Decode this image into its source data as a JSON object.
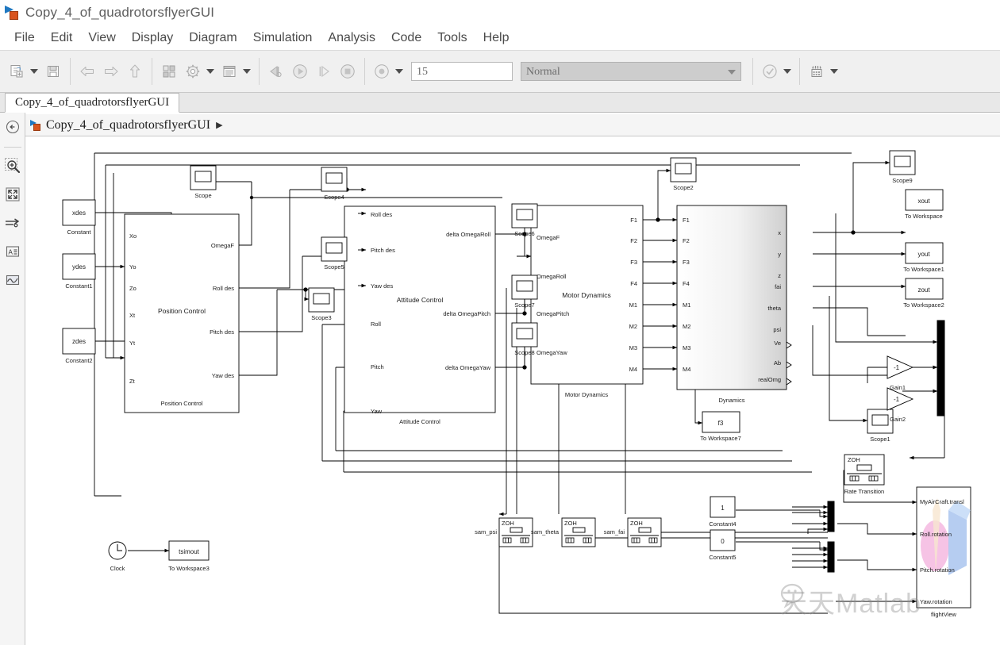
{
  "window": {
    "title": "Copy_4_of_quadrotorsflyerGUI",
    "app_icon": "simulink-model-icon"
  },
  "menubar": {
    "items": [
      "File",
      "Edit",
      "View",
      "Display",
      "Diagram",
      "Simulation",
      "Analysis",
      "Code",
      "Tools",
      "Help"
    ]
  },
  "toolbar": {
    "new_model": "new-model-icon",
    "save": "save-icon",
    "back": "back-arrow-icon",
    "forward": "forward-arrow-icon",
    "up": "up-arrow-icon",
    "library_browser": "library-browser-icon",
    "model_config": "gear-icon",
    "model_explorer": "model-explorer-icon",
    "step_back": "step-back-icon",
    "run": "run-icon",
    "step_forward": "step-forward-icon",
    "stop": "stop-icon",
    "fast_restart": "fast-restart-icon",
    "stop_time_value": "15",
    "sim_mode_value": "Normal",
    "update_model": "check-icon",
    "build_model": "build-icon"
  },
  "tabstrip": {
    "model_tab_label": "Copy_4_of_quadrotorsflyerGUI"
  },
  "breadcrumb": {
    "root": "Copy_4_of_quadrotorsflyerGUI",
    "separator": "▶"
  },
  "rail": {
    "items": [
      {
        "name": "navigate-back-icon",
        "label": "Navigate back"
      },
      {
        "name": "zoom-icon",
        "label": "Zoom"
      },
      {
        "name": "fit-to-view-icon",
        "label": "Fit to view"
      },
      {
        "name": "signal-routing-icon",
        "label": "Signal routing"
      },
      {
        "name": "annotation-icon",
        "label": "Annotation"
      },
      {
        "name": "scope-viewer-icon",
        "label": "Scope viewer"
      }
    ]
  },
  "watermark": {
    "text": "天天Matlab",
    "icon": "wechat-icon"
  },
  "model": {
    "subsystems": [
      {
        "id": "position-control",
        "label": "Position Control",
        "caption": "Position Control",
        "inputs": [
          "Xo",
          "Yo",
          "Zo",
          "Xt",
          "Yt",
          "Zt"
        ],
        "outputs": [
          "OmegaF",
          "Roll des",
          "Pitch des",
          "Yaw des"
        ]
      },
      {
        "id": "attitude-control",
        "label": "Attitude Control",
        "caption": "Attitude Control",
        "inputs": [
          "Roll des",
          "Pitch des",
          "Yaw des",
          "Roll",
          "Pitch",
          "Yaw"
        ],
        "outputs": [
          "delta OmegaRoll",
          "delta OmegaPitch",
          "delta OmegaYaw"
        ]
      },
      {
        "id": "motor-dynamics",
        "label": "Motor Dynamics",
        "caption": "Motor Dynamics",
        "inputs": [
          "OmegaF",
          "OmegaRoll",
          "OmegaPitch",
          "OmegaYaw"
        ],
        "outputs": [
          "F1",
          "F2",
          "F3",
          "F4",
          "M1",
          "M2",
          "M3",
          "M4"
        ]
      },
      {
        "id": "dynamics",
        "label": "",
        "caption": "Dynamics",
        "inputs": [
          "F1",
          "F2",
          "F3",
          "F4",
          "M1",
          "M2",
          "M3",
          "M4"
        ],
        "outputs": [
          "x",
          "y",
          "z",
          "fai",
          "theta",
          "psi",
          "Ve",
          "Ab",
          "realOmg"
        ]
      }
    ],
    "constants": [
      {
        "value": "xdes",
        "caption": "Constant"
      },
      {
        "value": "ydes",
        "caption": "Constant1"
      },
      {
        "value": "zdes",
        "caption": "Constant2"
      },
      {
        "value": "1",
        "caption": "Constant4"
      },
      {
        "value": "0",
        "caption": "Constant5"
      }
    ],
    "scopes": [
      {
        "caption": "Scope"
      },
      {
        "caption": "Scope4"
      },
      {
        "caption": "Scope5"
      },
      {
        "caption": "Scope3"
      },
      {
        "caption": "Scope6"
      },
      {
        "caption": "Scope7"
      },
      {
        "caption": "Scope8"
      },
      {
        "caption": "Scope2"
      },
      {
        "caption": "Scope9"
      },
      {
        "caption": "Scope1"
      }
    ],
    "to_workspace": [
      {
        "value": "xout",
        "caption": "To Workspace"
      },
      {
        "value": "yout",
        "caption": "To Workspace1"
      },
      {
        "value": "zout",
        "caption": "To Workspace2"
      },
      {
        "value": "tsimout",
        "caption": "To Workspace3"
      },
      {
        "value": "f3",
        "caption": "To Workspace7"
      }
    ],
    "gains": [
      {
        "value": "-1",
        "caption": "Gain1"
      },
      {
        "value": "-1",
        "caption": "Gain2"
      }
    ],
    "clock": {
      "caption": "Clock"
    },
    "rate_transition": {
      "label": "ZOH",
      "caption": "Rate Transition"
    },
    "zoh_blocks": [
      {
        "label": "ZOH",
        "signal": "sam_psi"
      },
      {
        "label": "ZOH",
        "signal": "sam_theta"
      },
      {
        "label": "ZOH",
        "signal": "sam_fai"
      }
    ],
    "flight_view": {
      "caption": "flightView",
      "inputs": [
        "MyAirCraft.transl",
        "Roll.rotation",
        "Pitch.rotation",
        "Yaw.rotation"
      ]
    }
  }
}
